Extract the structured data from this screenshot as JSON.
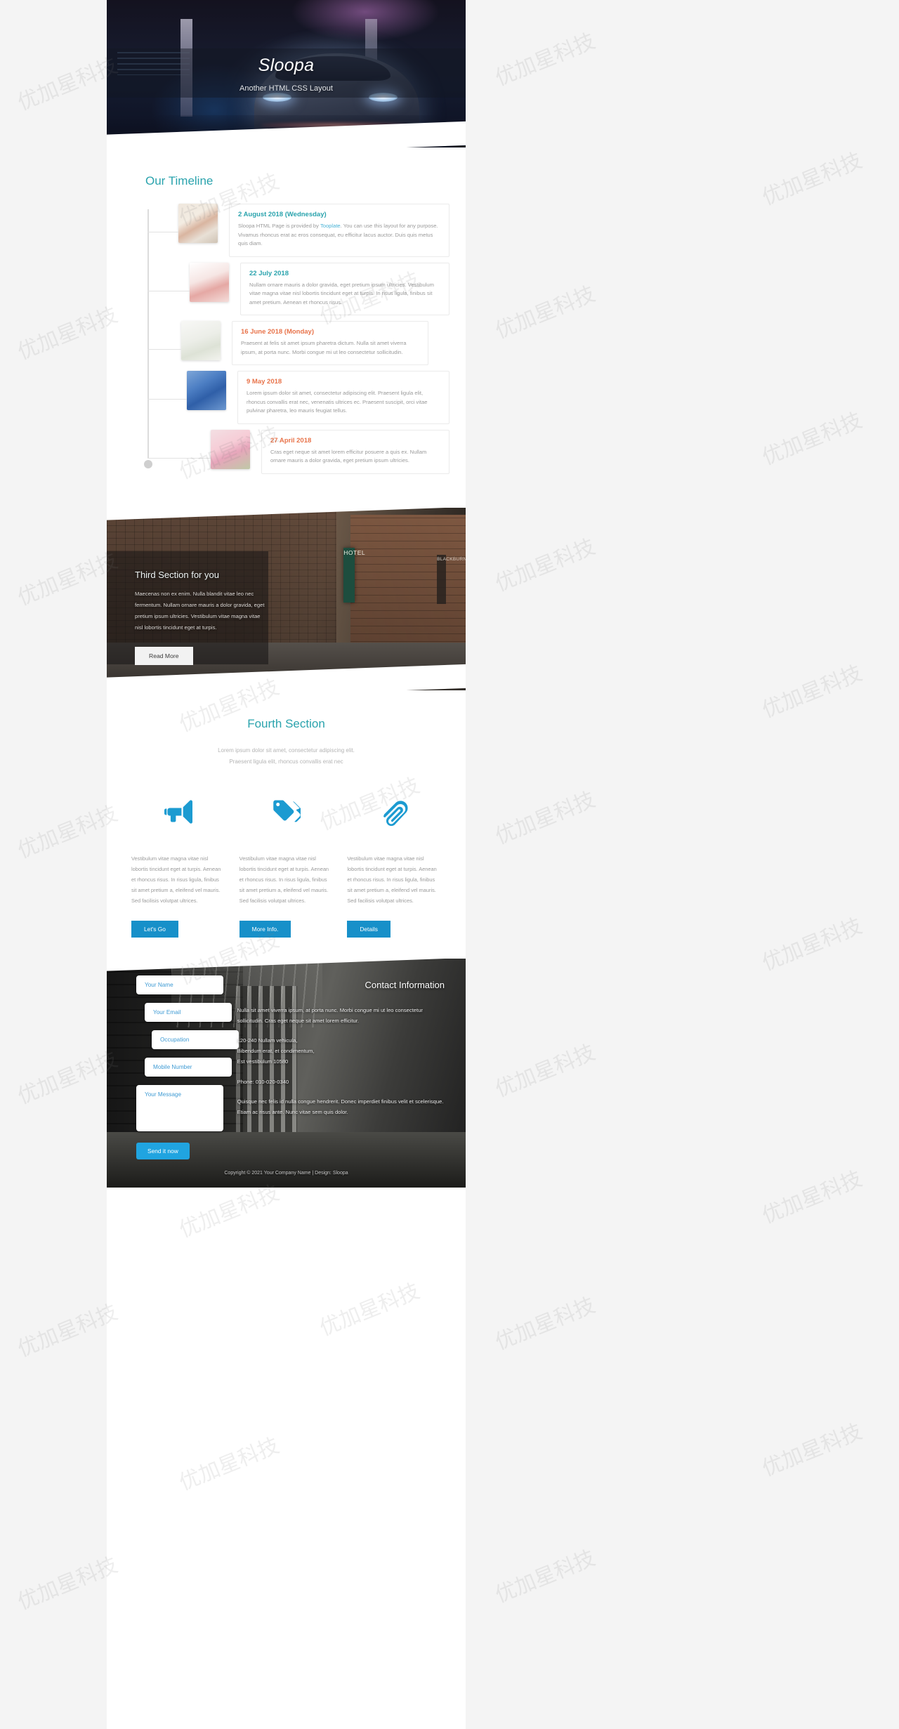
{
  "hero": {
    "title": "Sloopa",
    "subtitle": "Another HTML CSS Layout"
  },
  "timeline": {
    "heading": "Our Timeline",
    "items": [
      {
        "date": "2 August 2018 (Wednesday)",
        "color": "teal",
        "text_before": "Sloopa HTML Page is provided by ",
        "link": "Tooplate",
        "text_after": ". You can use this layout for any purpose. Vivamus rhoncus erat ac eros consequat, eu efficitur lacus auctor. Duis quis metus quis diam."
      },
      {
        "date": "22 July 2018",
        "color": "teal",
        "text_before": "Nullam ornare mauris a dolor gravida, eget pretium ipsum ultricies. Vestibulum vitae magna vitae nisl lobortis tincidunt eget at turpis. In risus ligula, finibus sit amet pretium. Aenean et rhoncus risus.",
        "link": "",
        "text_after": ""
      },
      {
        "date": "16 June 2018 (Monday)",
        "color": "orange",
        "text_before": "Praesent at felis sit amet ipsum pharetra dictum. Nulla sit amet viverra ipsum, at porta nunc. Morbi congue mi ut leo consectetur sollicitudin.",
        "link": "",
        "text_after": ""
      },
      {
        "date": "9 May 2018",
        "color": "orange",
        "text_before": "Lorem ipsum dolor sit amet, consectetur adipiscing elit. Praesent ligula elit, rhoncus convallis erat nec, venenatis ultrices ec. Praesent suscipit, orci vitae pulvinar pharetra, leo mauris feugiat tellus.",
        "link": "",
        "text_after": ""
      },
      {
        "date": "27 April 2018",
        "color": "orange",
        "text_before": "Cras eget neque sit amet lorem efficitur posuere a quis ex. Nullam ornare mauris a dolor gravida, eget pretium ipsum ultricies.",
        "link": "",
        "text_after": ""
      }
    ]
  },
  "third": {
    "title": "Third Section for you",
    "description": "Maecenas non ex enim. Nulla blandit vitae leo nec fermentum. Nullam ornare mauris a dolor gravida, eget pretium ipsum ultricies. Vestibulum vitae magna vitae nisl lobortis tincidunt eget at turpis.",
    "button": "Read More",
    "sign_hotel": "HOTEL",
    "sign_blackburn": "BLACKBURN"
  },
  "fourth": {
    "title": "Fourth Section",
    "subtitle_line1": "Lorem ipsum dolor sit amet, consectetur adipiscing elit.",
    "subtitle_line2": "Praesent ligula elit, rhoncus convallis erat nec",
    "columns": [
      {
        "icon": "megaphone-icon",
        "text": "Vestibulum vitae magna vitae nisl lobortis tincidunt eget at turpis. Aenean et rhoncus risus. In risus ligula, finibus sit amet pretium a, eleifend vel mauris. Sed facilisis volutpat ultrices.",
        "button": "Let's Go"
      },
      {
        "icon": "tags-icon",
        "text": "Vestibulum vitae magna vitae nisl lobortis tincidunt eget at turpis. Aenean et rhoncus risus. In risus ligula, finibus sit amet pretium a, eleifend vel mauris. Sed facilisis volutpat ultrices.",
        "button": "More Info."
      },
      {
        "icon": "paperclip-icon",
        "text": "Vestibulum vitae magna vitae nisl lobortis tincidunt eget at turpis. Aenean et rhoncus risus. In risus ligula, finibus sit amet pretium a, eleifend vel mauris. Sed facilisis volutpat ultrices.",
        "button": "Details"
      }
    ]
  },
  "contact": {
    "title": "Contact Information",
    "form": {
      "name_placeholder": "Your Name",
      "email_placeholder": "Your Email",
      "occupation_placeholder": "Occupation",
      "mobile_placeholder": "Mobile Number",
      "message_placeholder": "Your Message",
      "submit_label": "Send it now"
    },
    "paragraph": "Nulla sit amet viverra ipsum, at porta nunc. Morbi congue mi ut leo consectetur sollicitudin. Cras eget neque sit amet lorem efficitur.",
    "address_line1": "120-240 Nullam vehicula,",
    "address_line2": "Bibendum erat, et condimentum,",
    "address_line3": "Est vestibulum 10580",
    "phone": "Phone: 010-020-0340",
    "paragraph2": "Quisque nec felis id nulla congue hendrerit. Donec imperdiet finibus velit et scelerisque. Etiam ac risus ante. Nunc vitae sem quis dolor."
  },
  "footer": {
    "copyright": "Copyright © 2021 Your Company Name | Design: Sloopa"
  },
  "colors": {
    "teal": "#2aa3ad",
    "orange": "#e8734a",
    "blue": "#1790c9",
    "send_blue": "#20a4e0"
  },
  "watermark": "优加星科技"
}
